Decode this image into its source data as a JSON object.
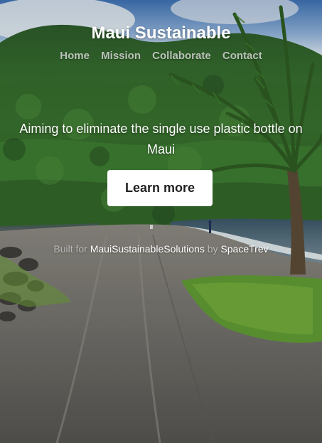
{
  "header": {
    "title": "Maui Sustainable"
  },
  "nav": {
    "items": [
      {
        "label": "Home"
      },
      {
        "label": "Mission"
      },
      {
        "label": "Collaborate"
      },
      {
        "label": "Contact"
      }
    ]
  },
  "hero": {
    "tagline": "Aiming to eliminate the single use plastic bottle on Maui",
    "cta_label": "Learn more"
  },
  "footer": {
    "built_for_prefix": "Built for",
    "organization_link": "MauiSustainableSolutions",
    "by_word": "by",
    "author_link": "SpaceTrev"
  },
  "colors": {
    "button_background": "#ffffff",
    "button_text": "#222222",
    "title_text": "#ffffff"
  }
}
